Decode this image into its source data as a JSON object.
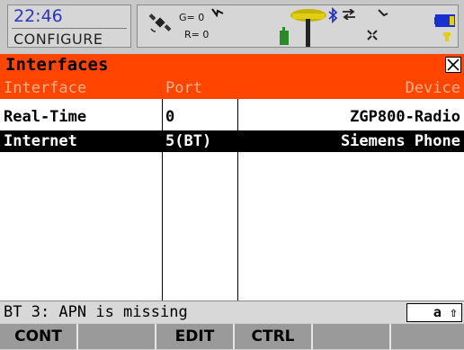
{
  "status": {
    "time": "22:46",
    "mode": "CONFIGURE",
    "satellites_g": "G= 0",
    "satellites_r": "R= 0",
    "icons": [
      "satellite-icon",
      "gnss-antenna-icon",
      "bluetooth-icon",
      "link-icon",
      "battery-icon"
    ]
  },
  "dialog": {
    "title": "Interfaces"
  },
  "table": {
    "headers": [
      "Interface",
      "Port",
      "Device"
    ],
    "rows": [
      {
        "interface": "Real-Time",
        "port": "0",
        "device": "ZGP800-Radio",
        "selected": false
      },
      {
        "interface": "Internet",
        "port": "5(BT)",
        "device": "Siemens Phone",
        "selected": true
      }
    ]
  },
  "message": {
    "text": "BT 3: APN is missing",
    "input_mode": "a ⇧"
  },
  "softkeys": [
    "CONT",
    "",
    "EDIT",
    "CTRL",
    "",
    ""
  ],
  "colors": {
    "title_bar": "#ff4500",
    "time_text": "#2a35c4",
    "selected_row": "#000000",
    "softkey": "#9a9a9a"
  }
}
